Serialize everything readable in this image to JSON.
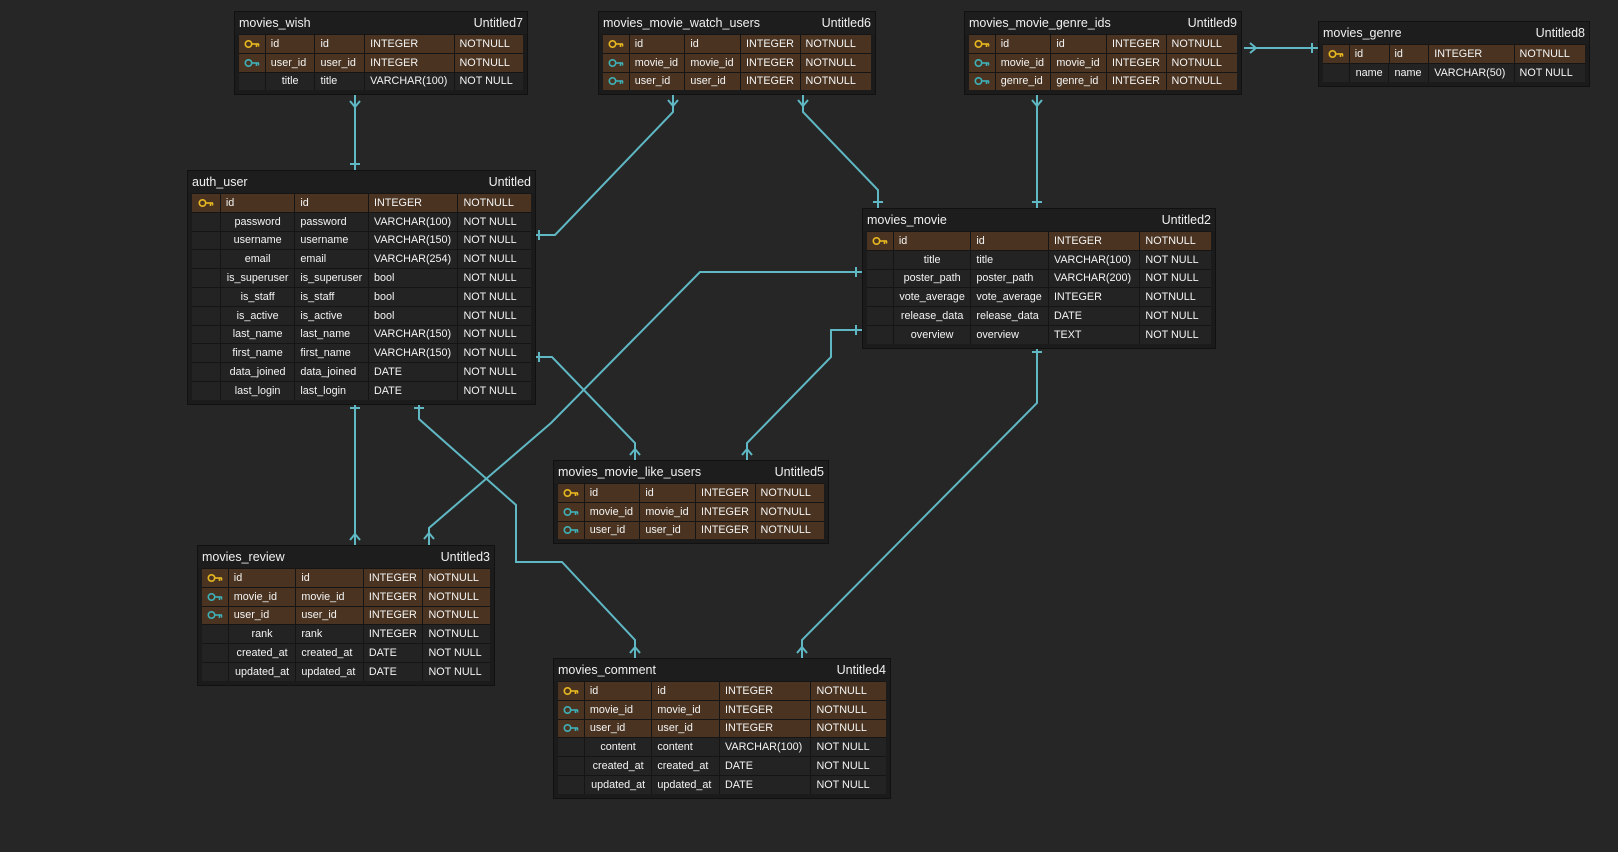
{
  "colors": {
    "background": "#262626",
    "table_bg": "#1b1b1b",
    "key_row_bg": "#4a3421",
    "plain_row_bg": "#232323",
    "relation_line": "#5fb8c4",
    "primary_key_icon": "#e8b820",
    "foreign_key_icon": "#3fb0b8"
  },
  "tables": [
    {
      "id": "movies_wish",
      "name": "movies_wish",
      "tag": "Untitled7",
      "rows": [
        {
          "icon": "primary-key-icon",
          "logical": "id",
          "physical": "id",
          "type": "INTEGER",
          "constraint": "NOTNULL"
        },
        {
          "icon": "foreign-key-icon",
          "logical": "user_id",
          "physical": "user_id",
          "type": "INTEGER",
          "constraint": "NOTNULL"
        },
        {
          "icon": "",
          "logical": "title",
          "physical": "title",
          "type": "VARCHAR(100)",
          "constraint": "NOT NULL"
        }
      ]
    },
    {
      "id": "movies_movie_watch_users",
      "name": "movies_movie_watch_users",
      "tag": "Untitled6",
      "rows": [
        {
          "icon": "primary-key-icon",
          "logical": "id",
          "physical": "id",
          "type": "INTEGER",
          "constraint": "NOTNULL"
        },
        {
          "icon": "foreign-key-icon",
          "logical": "movie_id",
          "physical": "movie_id",
          "type": "INTEGER",
          "constraint": "NOTNULL"
        },
        {
          "icon": "foreign-key-icon",
          "logical": "user_id",
          "physical": "user_id",
          "type": "INTEGER",
          "constraint": "NOTNULL"
        }
      ]
    },
    {
      "id": "movies_movie_genre_ids",
      "name": "movies_movie_genre_ids",
      "tag": "Untitled9",
      "rows": [
        {
          "icon": "primary-key-icon",
          "logical": "id",
          "physical": "id",
          "type": "INTEGER",
          "constraint": "NOTNULL"
        },
        {
          "icon": "foreign-key-icon",
          "logical": "movie_id",
          "physical": "movie_id",
          "type": "INTEGER",
          "constraint": "NOTNULL"
        },
        {
          "icon": "foreign-key-icon",
          "logical": "genre_id",
          "physical": "genre_id",
          "type": "INTEGER",
          "constraint": "NOTNULL"
        }
      ]
    },
    {
      "id": "movies_genre",
      "name": "movies_genre",
      "tag": "Untitled8",
      "rows": [
        {
          "icon": "primary-key-icon",
          "logical": "id",
          "physical": "id",
          "type": "INTEGER",
          "constraint": "NOTNULL"
        },
        {
          "icon": "",
          "logical": "name",
          "physical": "name",
          "type": "VARCHAR(50)",
          "constraint": "NOT NULL"
        }
      ]
    },
    {
      "id": "auth_user",
      "name": "auth_user",
      "tag": "Untitled",
      "rows": [
        {
          "icon": "primary-key-icon",
          "logical": "id",
          "physical": "id",
          "type": "INTEGER",
          "constraint": "NOTNULL"
        },
        {
          "icon": "",
          "logical": "password",
          "physical": "password",
          "type": "VARCHAR(100)",
          "constraint": "NOT NULL"
        },
        {
          "icon": "",
          "logical": "username",
          "physical": "username",
          "type": "VARCHAR(150)",
          "constraint": "NOT NULL"
        },
        {
          "icon": "",
          "logical": "email",
          "physical": "email",
          "type": "VARCHAR(254)",
          "constraint": "NOT NULL"
        },
        {
          "icon": "",
          "logical": "is_superuser",
          "physical": "is_superuser",
          "type": "bool",
          "constraint": "NOT NULL"
        },
        {
          "icon": "",
          "logical": "is_staff",
          "physical": "is_staff",
          "type": "bool",
          "constraint": "NOT NULL"
        },
        {
          "icon": "",
          "logical": "is_active",
          "physical": "is_active",
          "type": "bool",
          "constraint": "NOT NULL"
        },
        {
          "icon": "",
          "logical": "last_name",
          "physical": "last_name",
          "type": "VARCHAR(150)",
          "constraint": "NOT NULL"
        },
        {
          "icon": "",
          "logical": "first_name",
          "physical": "first_name",
          "type": "VARCHAR(150)",
          "constraint": "NOT NULL"
        },
        {
          "icon": "",
          "logical": "data_joined",
          "physical": "data_joined",
          "type": "DATE",
          "constraint": "NOT NULL"
        },
        {
          "icon": "",
          "logical": "last_login",
          "physical": "last_login",
          "type": "DATE",
          "constraint": "NOT NULL"
        }
      ]
    },
    {
      "id": "movies_movie",
      "name": "movies_movie",
      "tag": "Untitled2",
      "rows": [
        {
          "icon": "primary-key-icon",
          "logical": "id",
          "physical": "id",
          "type": "INTEGER",
          "constraint": "NOTNULL"
        },
        {
          "icon": "",
          "logical": "title",
          "physical": "title",
          "type": "VARCHAR(100)",
          "constraint": "NOT NULL"
        },
        {
          "icon": "",
          "logical": "poster_path",
          "physical": "poster_path",
          "type": "VARCHAR(200)",
          "constraint": "NOT NULL"
        },
        {
          "icon": "",
          "logical": "vote_average",
          "physical": "vote_average",
          "type": "INTEGER",
          "constraint": "NOTNULL"
        },
        {
          "icon": "",
          "logical": "release_data",
          "physical": "release_data",
          "type": "DATE",
          "constraint": "NOT NULL"
        },
        {
          "icon": "",
          "logical": "overview",
          "physical": "overview",
          "type": "TEXT",
          "constraint": "NOT NULL"
        }
      ]
    },
    {
      "id": "movies_movie_like_users",
      "name": "movies_movie_like_users",
      "tag": "Untitled5",
      "rows": [
        {
          "icon": "primary-key-icon",
          "logical": "id",
          "physical": "id",
          "type": "INTEGER",
          "constraint": "NOTNULL"
        },
        {
          "icon": "foreign-key-icon",
          "logical": "movie_id",
          "physical": "movie_id",
          "type": "INTEGER",
          "constraint": "NOTNULL"
        },
        {
          "icon": "foreign-key-icon",
          "logical": "user_id",
          "physical": "user_id",
          "type": "INTEGER",
          "constraint": "NOTNULL"
        }
      ]
    },
    {
      "id": "movies_review",
      "name": "movies_review",
      "tag": "Untitled3",
      "rows": [
        {
          "icon": "primary-key-icon",
          "logical": "id",
          "physical": "id",
          "type": "INTEGER",
          "constraint": "NOTNULL"
        },
        {
          "icon": "foreign-key-icon",
          "logical": "movie_id",
          "physical": "movie_id",
          "type": "INTEGER",
          "constraint": "NOTNULL"
        },
        {
          "icon": "foreign-key-icon",
          "logical": "user_id",
          "physical": "user_id",
          "type": "INTEGER",
          "constraint": "NOTNULL"
        },
        {
          "icon": "",
          "logical": "rank",
          "physical": "rank",
          "type": "INTEGER",
          "constraint": "NOTNULL"
        },
        {
          "icon": "",
          "logical": "created_at",
          "physical": "created_at",
          "type": "DATE",
          "constraint": "NOT NULL"
        },
        {
          "icon": "",
          "logical": "updated_at",
          "physical": "updated_at",
          "type": "DATE",
          "constraint": "NOT NULL"
        }
      ]
    },
    {
      "id": "movies_comment",
      "name": "movies_comment",
      "tag": "Untitled4",
      "rows": [
        {
          "icon": "primary-key-icon",
          "logical": "id",
          "physical": "id",
          "type": "INTEGER",
          "constraint": "NOTNULL"
        },
        {
          "icon": "foreign-key-icon",
          "logical": "movie_id",
          "physical": "movie_id",
          "type": "INTEGER",
          "constraint": "NOTNULL"
        },
        {
          "icon": "foreign-key-icon",
          "logical": "user_id",
          "physical": "user_id",
          "type": "INTEGER",
          "constraint": "NOTNULL"
        },
        {
          "icon": "",
          "logical": "content",
          "physical": "content",
          "type": "VARCHAR(100)",
          "constraint": "NOT NULL"
        },
        {
          "icon": "",
          "logical": "created_at",
          "physical": "created_at",
          "type": "DATE",
          "constraint": "NOT NULL"
        },
        {
          "icon": "",
          "logical": "updated_at",
          "physical": "updated_at",
          "type": "DATE",
          "constraint": "NOT NULL"
        }
      ]
    }
  ],
  "relationships": [
    {
      "from": "movies_wish",
      "to": "auth_user"
    },
    {
      "from": "movies_movie_watch_users",
      "to": "auth_user"
    },
    {
      "from": "movies_movie_watch_users",
      "to": "movies_movie"
    },
    {
      "from": "movies_movie_genre_ids",
      "to": "movies_movie"
    },
    {
      "from": "movies_movie_genre_ids",
      "to": "movies_genre"
    },
    {
      "from": "movies_review",
      "to": "movies_movie"
    },
    {
      "from": "movies_movie_like_users",
      "to": "auth_user"
    },
    {
      "from": "movies_movie_like_users",
      "to": "movies_movie"
    },
    {
      "from": "movies_review",
      "to": "auth_user"
    },
    {
      "from": "movies_comment",
      "to": "auth_user"
    },
    {
      "from": "movies_comment",
      "to": "movies_movie"
    }
  ]
}
